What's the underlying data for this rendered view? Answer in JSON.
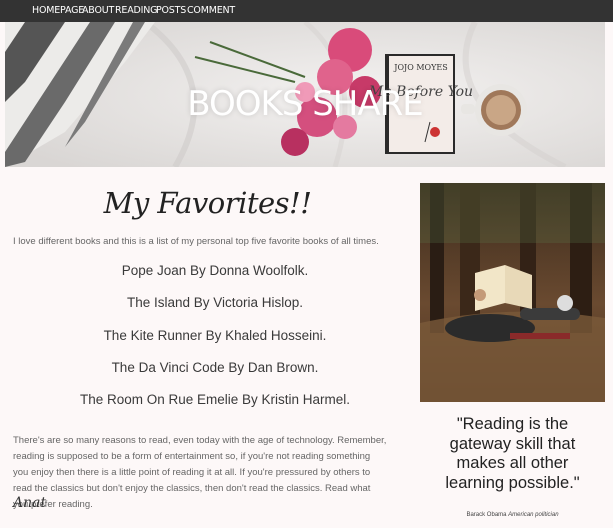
{
  "nav": {
    "items": [
      "HOMEPAGE",
      "ABOUT",
      "READING",
      "POSTS",
      "COMMENT"
    ]
  },
  "hero": {
    "title": "BOOKS SHARE",
    "book_author": "JOJO MOYES",
    "book_title": "Me Before You"
  },
  "favorites": {
    "title": "My Favorites!!",
    "intro": "I love different books and this is a list of my personal top five favorite books of all times.",
    "books": [
      "Pope Joan By Donna Woolfolk.",
      "The Island By Victoria Hislop.",
      "The Kite Runner By Khaled Hosseini.",
      "The Da Vinci Code By Dan Brown.",
      "The Room On Rue Emelie By Kristin Harmel."
    ],
    "paragraph": "There's are so many reasons to read, even today with the age of technology. Remember, reading is supposed to be a form of entertainment so, if you're not reading something you enjoy then there is a little point of reading it at all. If you're pressured by others to read the classics but don't enjoy the classics, then don't read the classics. Read what you prefer reading.",
    "signature": "Anat"
  },
  "sidebar": {
    "quote": "\"Reading is the gateway skill that makes all other learning possible.\"",
    "author_name": "Barack Obama",
    "author_role": "American politician"
  },
  "colors": {
    "nav_bg": "#333333",
    "page_bg": "#fdf8f8",
    "text_muted": "#666666"
  }
}
